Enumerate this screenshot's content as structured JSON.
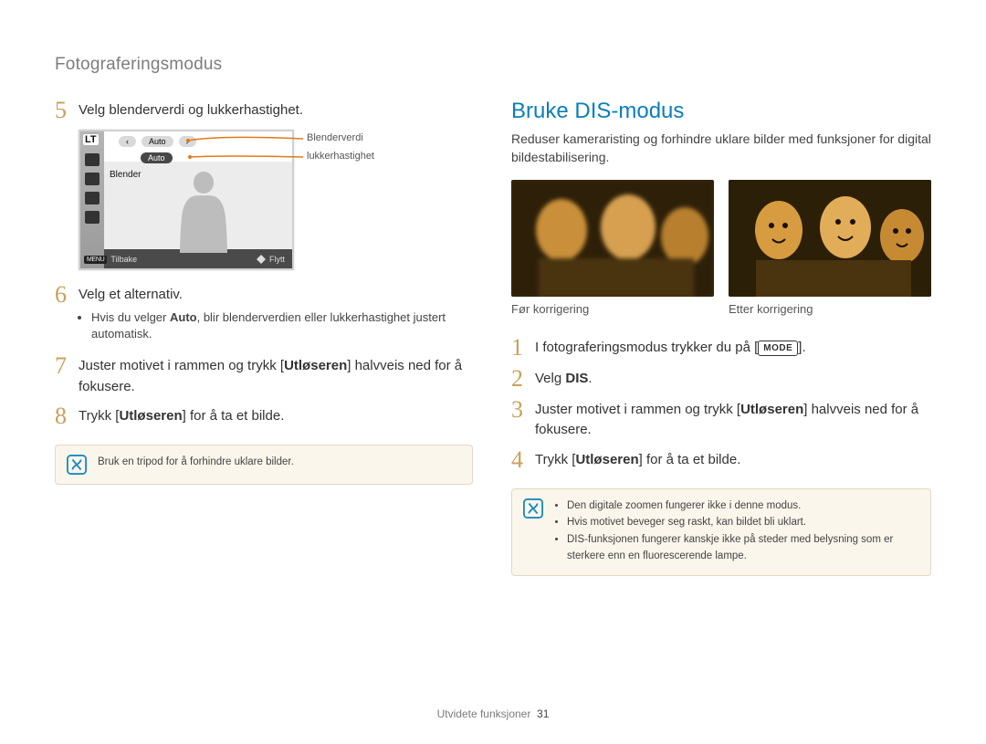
{
  "breadcrumb": "Fotograferingsmodus",
  "left": {
    "steps": {
      "s5": {
        "num": "5",
        "text": "Velg blenderverdi og lukkerhastighet."
      },
      "s6": {
        "num": "6",
        "text": "Velg et alternativ.",
        "bullet_pre": "Hvis du velger ",
        "bullet_bold": "Auto",
        "bullet_post": ", blir blenderverdien eller lukkerhastighet justert automatisk."
      },
      "s7": {
        "num": "7",
        "pre": "Juster motivet i rammen og trykk [",
        "bold": "Utløseren",
        "post": "] halvveis ned for å fokusere."
      },
      "s8": {
        "num": "8",
        "pre": "Trykk [",
        "bold": "Utløseren",
        "post": "] for å ta et bilde."
      }
    },
    "note": "Bruk en tripod for å forhindre uklare bilder.",
    "lcd": {
      "lt": "LT",
      "auto1": "Auto",
      "auto2": "Auto",
      "blender": "Blender",
      "back_label": "Tilbake",
      "menu_tag": "MENU",
      "move_label": "Flytt",
      "label1": "Blenderverdi",
      "label2": "lukkerhastighet"
    }
  },
  "right": {
    "title": "Bruke DIS-modus",
    "intro": "Reduser kameraristing og forhindre uklare bilder med funksjoner for digital bildestabilisering.",
    "cap_before": "Før korrigering",
    "cap_after": "Etter korrigering",
    "steps": {
      "s1": {
        "num": "1",
        "pre": "I fotograferingsmodus trykker du på [",
        "mode": "MODE",
        "post": "]."
      },
      "s2": {
        "num": "2",
        "pre": "Velg ",
        "bold": "DIS",
        "post": "."
      },
      "s3": {
        "num": "3",
        "pre": "Juster motivet i rammen og trykk [",
        "bold": "Utløseren",
        "post": "] halvveis ned for å fokusere."
      },
      "s4": {
        "num": "4",
        "pre": "Trykk [",
        "bold": "Utløseren",
        "post": "] for å ta et bilde."
      }
    },
    "note": {
      "b1": "Den digitale zoomen fungerer ikke i denne modus.",
      "b2": "Hvis motivet beveger seg raskt, kan bildet bli uklart.",
      "b3": "DIS-funksjonen fungerer kanskje ikke på steder med belysning som er sterkere enn en fluorescerende lampe."
    }
  },
  "footer": {
    "section": "Utvidete funksjoner",
    "page": "31"
  }
}
